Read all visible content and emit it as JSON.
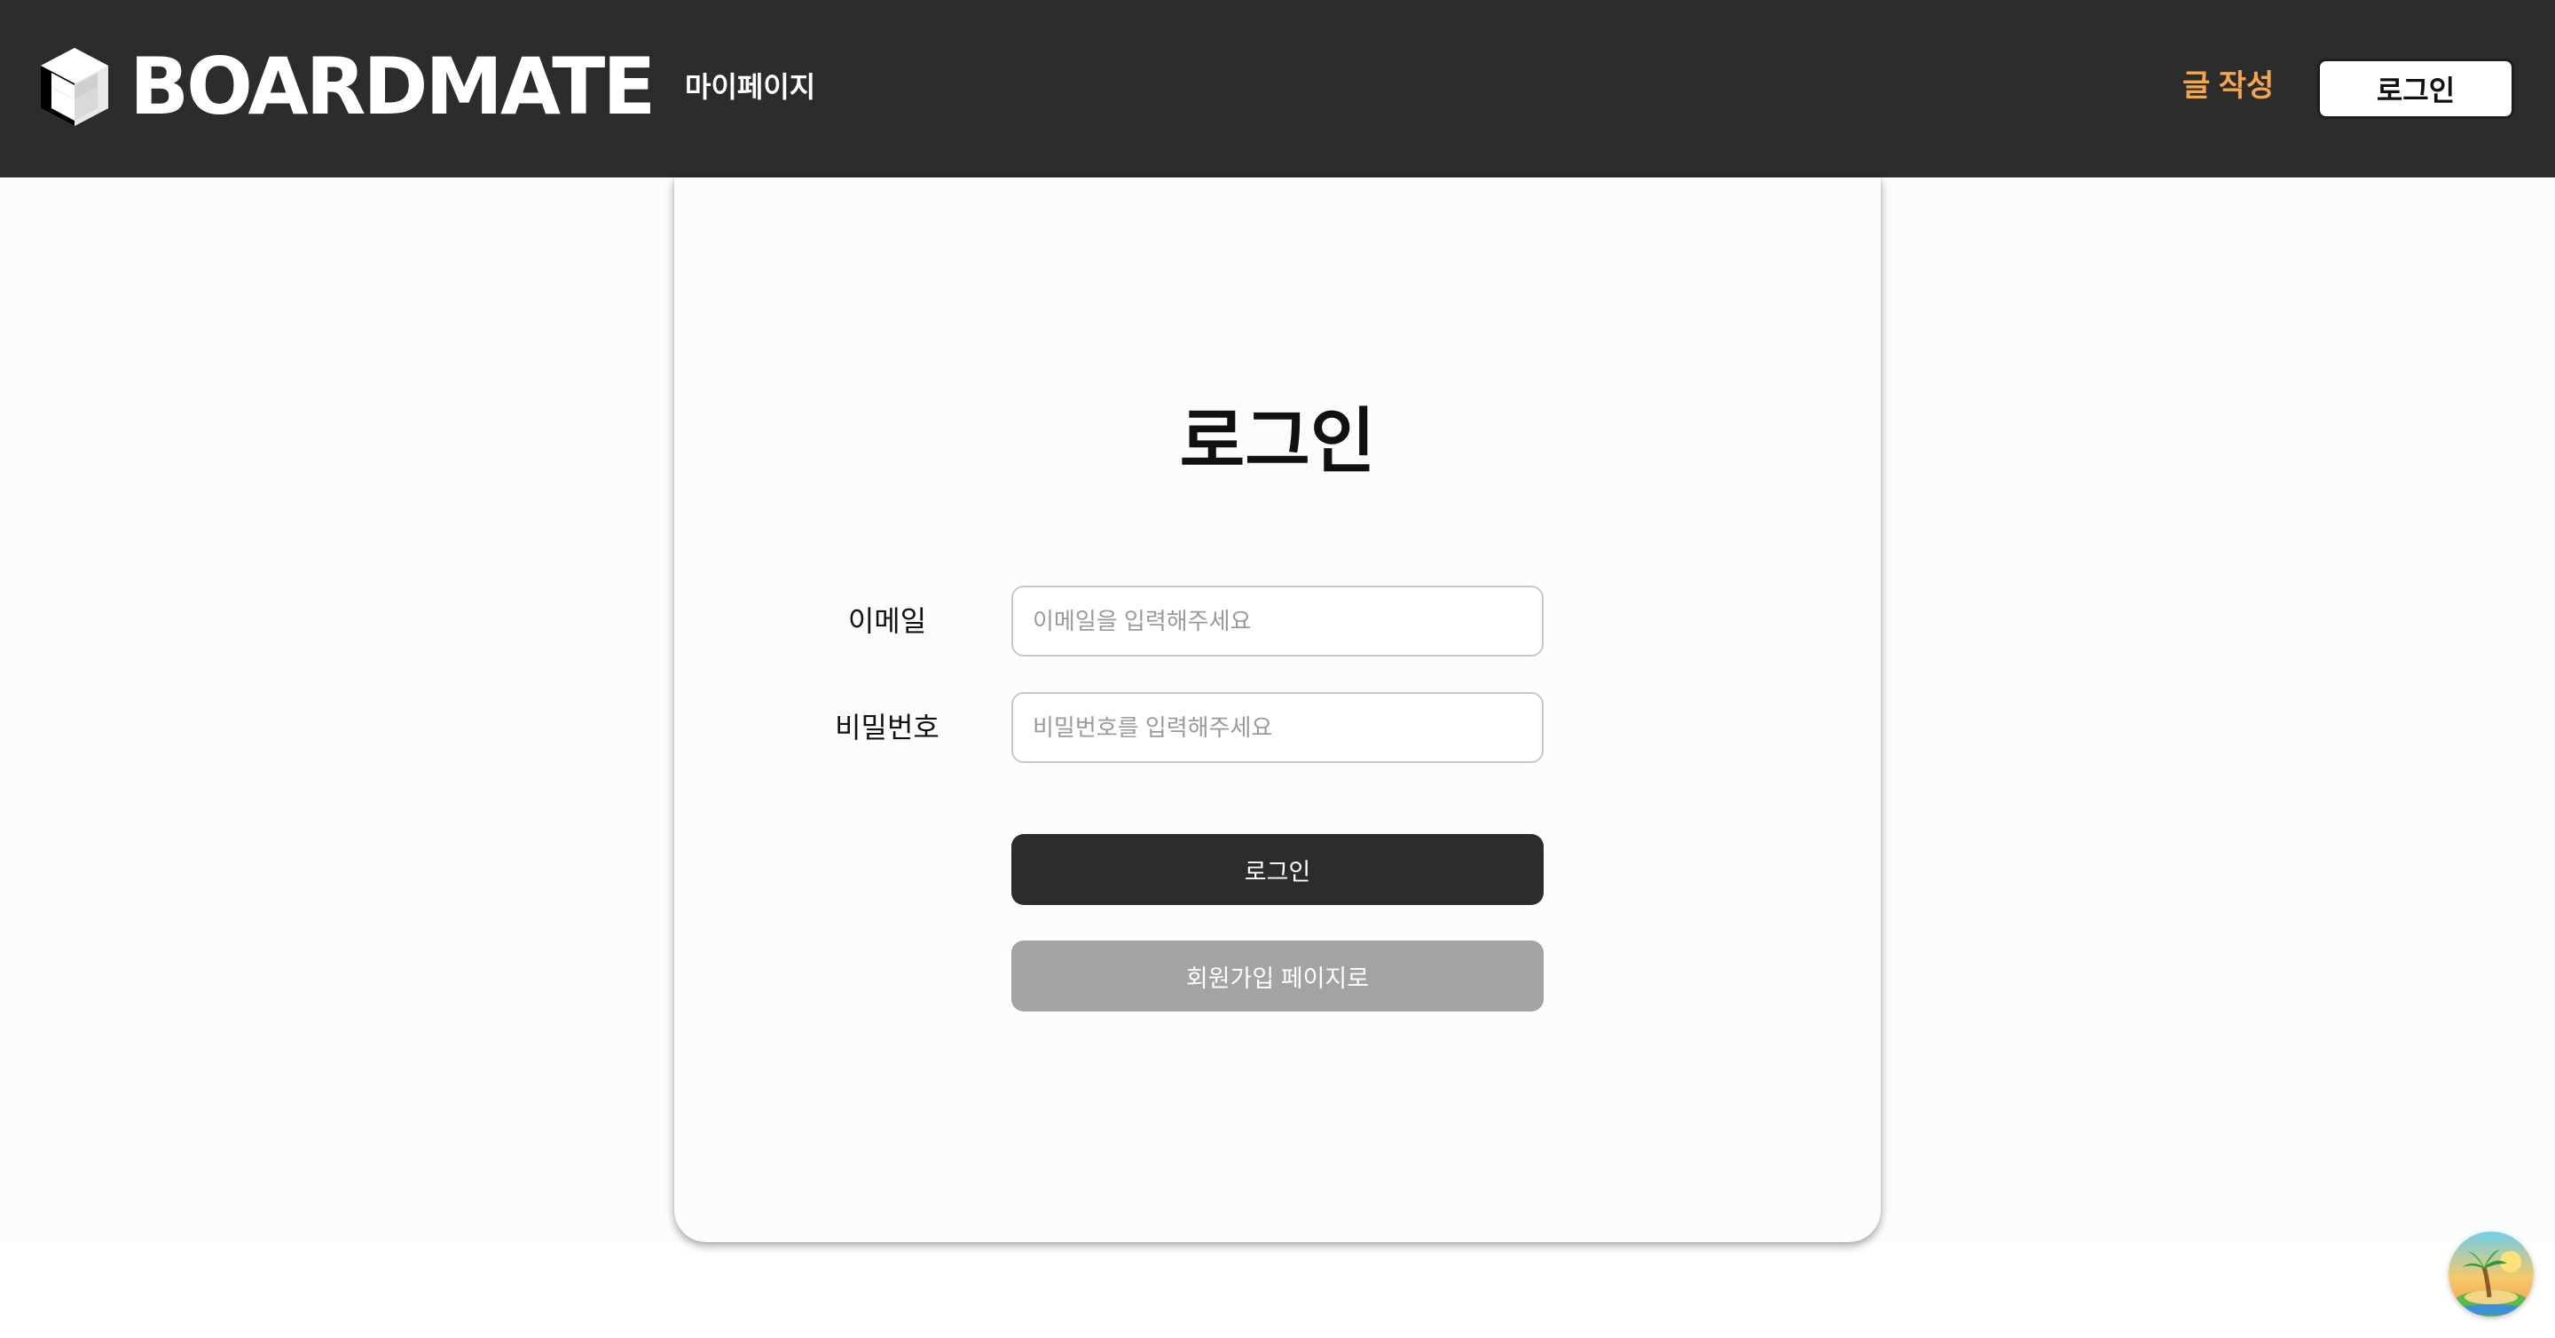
{
  "header": {
    "brand": "BOARDMATE",
    "nav_mypage": "마이페이지",
    "nav_write": "글 작성",
    "login_button": "로그인"
  },
  "login_form": {
    "title": "로그인",
    "email_label": "이메일",
    "email_placeholder": "이메일을 입력해주세요",
    "password_label": "비밀번호",
    "password_placeholder": "비밀번호를 입력해주세요",
    "submit_label": "로그인",
    "signup_label": "회원가입 페이지로"
  },
  "colors": {
    "header_bg": "#2c2c2c",
    "accent": "#f5a54a",
    "primary_button": "#2c2c2c",
    "secondary_button": "#a3a3a3"
  },
  "icons": {
    "logo": "cube-icon",
    "floating_badge": "beach-island-icon"
  }
}
